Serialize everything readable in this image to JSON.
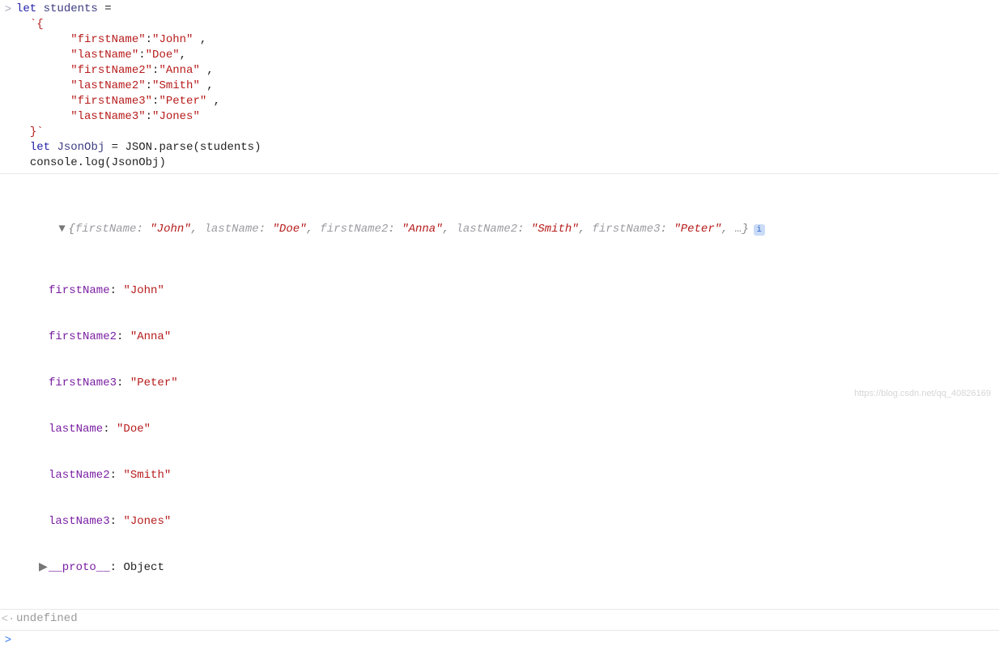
{
  "input": {
    "prompt_icon": ">",
    "line1_keyword": "let",
    "line1_var": "students",
    "line1_eq": " =",
    "backtick_open": "`{",
    "props": [
      {
        "key": "\"firstName\"",
        "val": "\"John\"",
        "trail": " ,"
      },
      {
        "key": "\"lastName\"",
        "val": "\"Doe\"",
        "trail": ","
      },
      {
        "key": "\"firstName2\"",
        "val": "\"Anna\"",
        "trail": " ,"
      },
      {
        "key": "\"lastName2\"",
        "val": "\"Smith\"",
        "trail": " ,"
      },
      {
        "key": "\"firstName3\"",
        "val": "\"Peter\"",
        "trail": " ,"
      },
      {
        "key": "\"lastName3\"",
        "val": "\"Jones\"",
        "trail": ""
      }
    ],
    "backtick_close": "}`",
    "line2_keyword": "let",
    "line2_var": "JsonObj",
    "line2_rhs": " = JSON.parse(students)",
    "line3": "console.log(JsonObj)"
  },
  "output": {
    "toggle_open": "▼",
    "toggle_closed": "▶",
    "summary_prefix": "{",
    "summary_pairs": [
      {
        "k": "firstName",
        "v": "\"John\""
      },
      {
        "k": "lastName",
        "v": "\"Doe\""
      },
      {
        "k": "firstName2",
        "v": "\"Anna\""
      },
      {
        "k": "lastName2",
        "v": "\"Smith\""
      },
      {
        "k": "firstName3",
        "v": "\"Peter\""
      }
    ],
    "summary_suffix": ", …}",
    "info_badge": "i",
    "expanded": [
      {
        "k": "firstName",
        "v": "\"John\""
      },
      {
        "k": "firstName2",
        "v": "\"Anna\""
      },
      {
        "k": "firstName3",
        "v": "\"Peter\""
      },
      {
        "k": "lastName",
        "v": "\"Doe\""
      },
      {
        "k": "lastName2",
        "v": "\"Smith\""
      },
      {
        "k": "lastName3",
        "v": "\"Jones\""
      }
    ],
    "proto_toggle": "▶",
    "proto_key": "__proto__",
    "proto_val": "Object"
  },
  "result": {
    "icon": "<·",
    "text": "undefined"
  },
  "next_prompt": ">",
  "watermark": "https://blog.csdn.net/qq_40826169"
}
